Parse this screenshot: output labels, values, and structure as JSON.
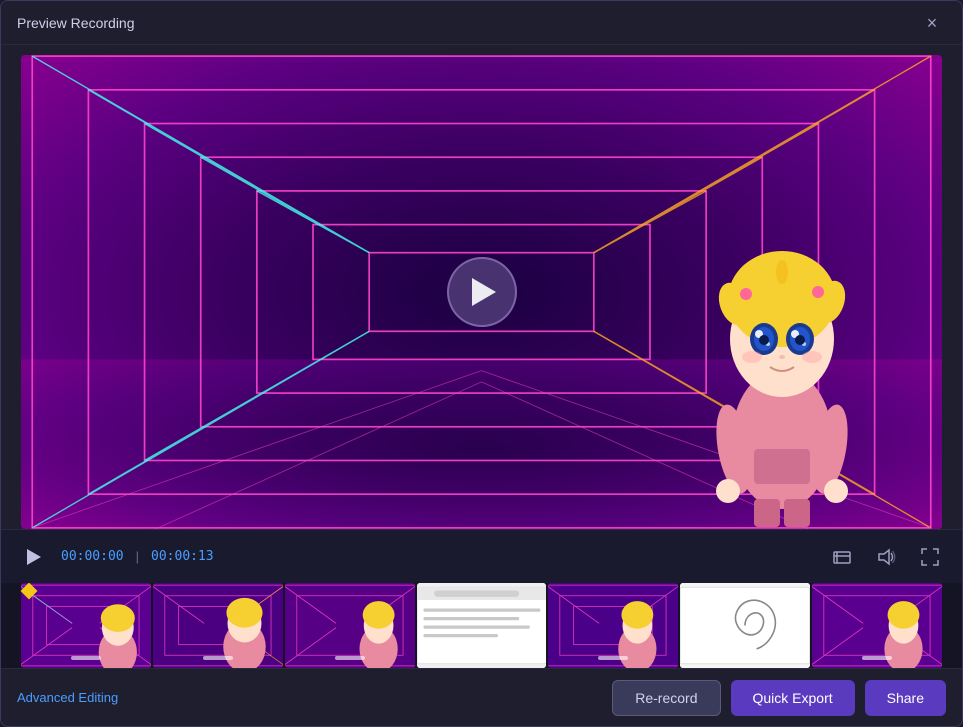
{
  "window": {
    "title": "Preview Recording",
    "close_label": "×"
  },
  "controls": {
    "time_current": "00:00:00",
    "time_separator": "|",
    "time_total": "00:00:13"
  },
  "bottom": {
    "advanced_editing_label": "Advanced Editing",
    "rerecord_label": "Re-record",
    "quick_export_label": "Quick Export",
    "share_label": "Share"
  },
  "colors": {
    "accent": "#5a3abe",
    "link": "#4a9eff",
    "time": "#4a9eff"
  }
}
